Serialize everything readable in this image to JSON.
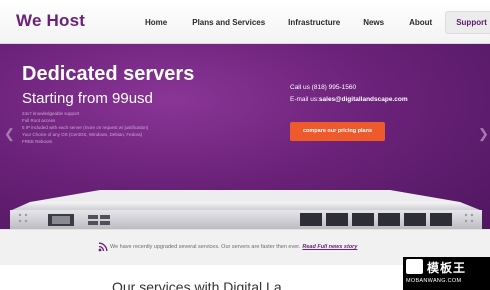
{
  "brand": {
    "logo": "We Host"
  },
  "nav": {
    "items": [
      {
        "label": "Home"
      },
      {
        "label": "Plans and Services"
      },
      {
        "label": "Infrastructure"
      },
      {
        "label": "News"
      },
      {
        "label": "About"
      },
      {
        "label": "Support"
      }
    ]
  },
  "hero": {
    "title": "Dedicated servers",
    "subtitle": "Starting from 99usd",
    "features": [
      "24x7 knowledgeable support",
      "Full Root access",
      "5 IP included with each server (more on request w/ justification)",
      "Your Choice of any OS (CentOS, Windows, Debian, Fedora)",
      "FREE Reboots"
    ],
    "phone": "Call us (818) 995-1560",
    "email_label": "E-mail us:",
    "email": "sales@digitallandscape.com",
    "cta_label": "compare our pricing plans",
    "prev_icon": "chevron-left-icon",
    "next_icon": "chevron-right-icon"
  },
  "news": {
    "icon": "rss-icon",
    "text": "We have recently upgraded several services. Our servers are faster then ever.",
    "link": "Read Full news story"
  },
  "section": {
    "heading_partial": "Our services with Digital La..."
  },
  "watermark": {
    "cn": "模板王",
    "url": "MOBANWANG.COM"
  },
  "colors": {
    "brand": "#6a2178",
    "hero": "#6b2279",
    "cta": "#ef5a2c"
  }
}
